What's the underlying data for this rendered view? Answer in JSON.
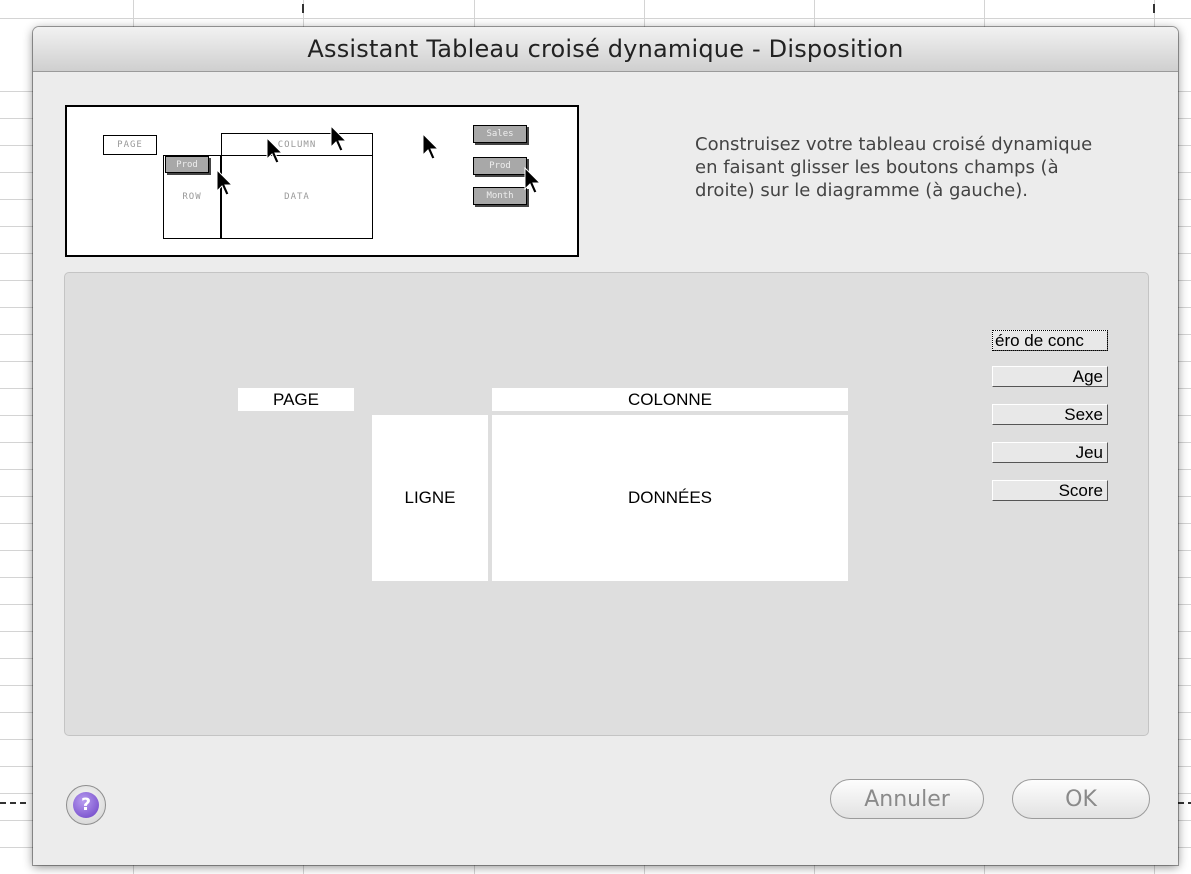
{
  "dialog": {
    "title": "Assistant Tableau croisé dynamique - Disposition",
    "instructions": "Construisez votre tableau croisé dynamique en faisant glisser les boutons champs (à droite) sur le diagramme (à gauche)."
  },
  "diagram": {
    "page": "PAGE",
    "column": "COLUMN",
    "row": "ROW",
    "data": "DATA",
    "buttons": [
      "Sales",
      "Prod",
      "Month"
    ],
    "row_button": "Prod"
  },
  "layout": {
    "zones": {
      "page": "PAGE",
      "column": "COLONNE",
      "row": "LIGNE",
      "data": "DONNÉES"
    },
    "fields": [
      "éro de conc",
      "Age",
      "Sexe",
      "Jeu",
      "Score"
    ]
  },
  "footer": {
    "help_icon": "question-icon",
    "cancel_label": "Annuler",
    "ok_label": "OK"
  },
  "colors": {
    "dialog_bg": "#ececec",
    "panel_bg": "#dedede",
    "help_accent": "#6a3fc4"
  }
}
